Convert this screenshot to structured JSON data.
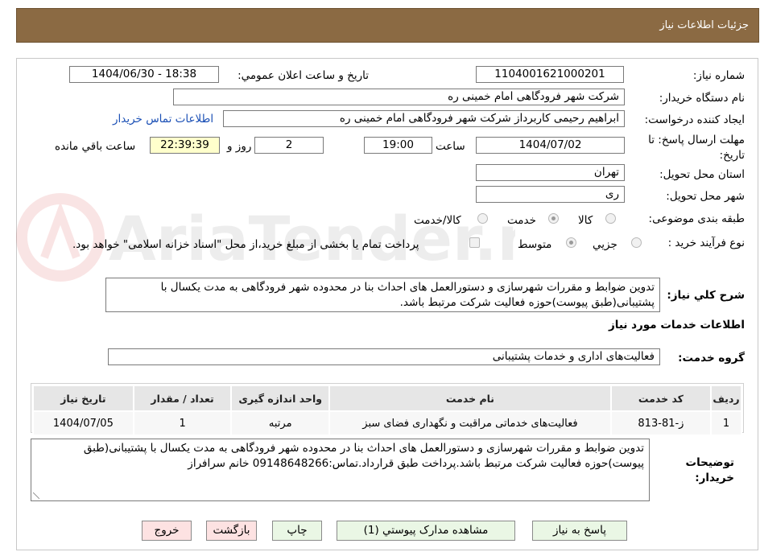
{
  "header": {
    "title": "جزئیات اطلاعات نیاز"
  },
  "fields": {
    "need_number_label": "شماره نیاز:",
    "need_number": "1104001621000201",
    "announce_label": "تاریخ و ساعت اعلان عمومي:",
    "announce_value": "1404/06/30 - 18:38",
    "buyer_org_label": "نام دستگاه خریدار:",
    "buyer_org": "شرکت شهر فرودگاهی امام خمینی  ره",
    "requester_label": "ایجاد کننده درخواست:",
    "requester": "ابراهیم رحیمی کاربرداز شرکت شهر فرودگاهی امام خمینی  ره",
    "contact_link": "اطلاعات تماس خریدار",
    "deadline_label": "مهلت ارسال پاسخ: تا تاریخ:",
    "deadline_date": "1404/07/02",
    "time_label": "ساعت",
    "deadline_time": "19:00",
    "days": "2",
    "days_label": "روز و",
    "remaining_time": "22:39:39",
    "remaining_label": "ساعت باقي مانده",
    "province_label": "استان محل تحویل:",
    "province": "تهران",
    "city_label": "شهر محل تحویل:",
    "city": "ری",
    "category_label": "طبقه بندی موضوعی:",
    "category_options": [
      "کالا",
      "خدمت",
      "کالا/خدمت"
    ],
    "category_selected": "خدمت",
    "process_label": "نوع فرآیند خرید :",
    "process_options": [
      "جزيي",
      "متوسط"
    ],
    "process_selected": "متوسط",
    "payment_note": "پرداخت تمام یا بخشی از مبلغ خرید،از محل \"اسناد خزانه اسلامی\" خواهد بود."
  },
  "description": {
    "label": "شرح کلي نیاز:",
    "text": "تدوین ضوابط و مقررات شهرسازی و دستورالعمل های احداث بنا در محدوده شهر فرودگاهی به مدت یکسال با پشتیبانی(طبق پیوست)حوزه فعالیت شرکت مرتبط باشد."
  },
  "services": {
    "section_title": "اطلاعات خدمات مورد نیاز",
    "group_label": "گروه خدمت:",
    "group_value": "فعالیت‌های اداری و خدمات پشتیبانی",
    "columns": [
      "ردیف",
      "کد خدمت",
      "نام خدمت",
      "واحد اندازه گیری",
      "تعداد / مقدار",
      "تاریخ نیاز"
    ],
    "rows": [
      [
        "1",
        "ز-81-813",
        "فعالیت‌های خدماتی مراقبت و نگهداری فضای سبز",
        "مرتبه",
        "1",
        "1404/07/05"
      ]
    ]
  },
  "buyer_notes": {
    "label": "توضیحات خریدار:",
    "text": "تدوین ضوابط و مقررات شهرسازی و دستورالعمل های احداث بنا در محدوده شهر فرودگاهی به مدت یکسال با پشتیبانی(طبق پیوست)حوزه فعالیت شرکت مرتبط باشد.پرداخت طبق قرارداد.تماس:09148648266 خانم سرافراز"
  },
  "buttons": {
    "respond": "پاسخ به نیاز",
    "attachments": "مشاهده مدارک پیوستي (1)",
    "print": "چاپ",
    "back": "بازگشت",
    "exit": "خروج"
  },
  "watermark": {
    "text": "AriaTender.neT",
    "icon": "aria-logo-icon"
  },
  "colors": {
    "header_bg": "#8b6a43",
    "button_green": "#eaf7e5",
    "button_red": "#fde2e2",
    "link": "#1a4fb5"
  }
}
